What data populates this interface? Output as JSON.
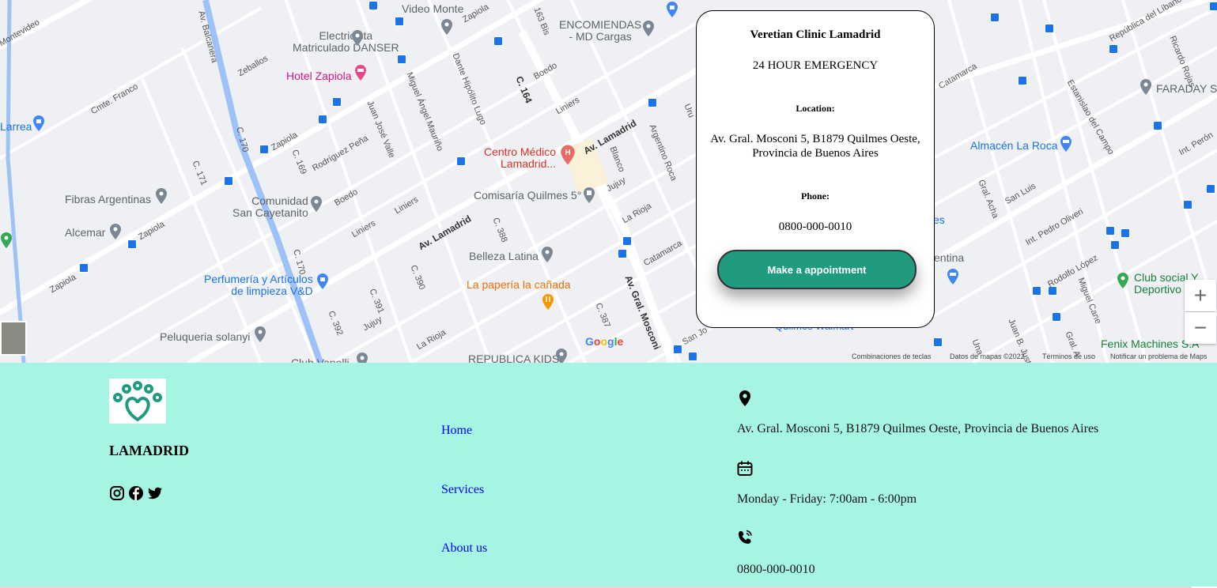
{
  "map": {
    "pois": [
      {
        "label": "Electricista\nMatriculado DANSER",
        "color": "gray"
      },
      {
        "label": "Video Monte",
        "color": "gray"
      },
      {
        "label": "ENCOMIENDAS\n- MD Cargas",
        "color": "gray"
      },
      {
        "label": "Hotel Zapiola",
        "color": "pink"
      },
      {
        "label": "Larrea",
        "color": "blue"
      },
      {
        "label": "Centro Médico\nLamadrid...",
        "color": "red"
      },
      {
        "label": "Fibras Argentinas",
        "color": "gray"
      },
      {
        "label": "Comunidad\nSan Cayetanito",
        "color": "gray"
      },
      {
        "label": "Comisaría Quilmes 5°",
        "color": "gray"
      },
      {
        "label": "Alcemar",
        "color": "gray"
      },
      {
        "label": "Belleza Latina",
        "color": "gray"
      },
      {
        "label": "Perfumería y Artículos\nde limpieza V&D",
        "color": "blue"
      },
      {
        "label": "La papería la cañada",
        "color": "orange"
      },
      {
        "label": "Peluqueria solanyi",
        "color": "gray"
      },
      {
        "label": "REPUBLICA KIDS",
        "color": "gray"
      },
      {
        "label": "FARADAY SA",
        "color": "gray"
      },
      {
        "label": "Almacén La Roca",
        "color": "blue"
      },
      {
        "label": "Club social Y\nDeportivo",
        "color": "green"
      },
      {
        "label": "Fenix Machines S.A",
        "color": "green"
      },
      {
        "label": "entina",
        "color": "gray"
      },
      {
        "label": "es",
        "color": "blue"
      },
      {
        "label": "Quilmes Walmart",
        "color": "blue"
      },
      {
        "label": "Club Vanelli",
        "color": "gray"
      }
    ],
    "streets": [
      "Zapiola",
      "Zapiola",
      "Zapiola",
      "Zapiola",
      "Av. Lamadrid",
      "Av. Lamadrid",
      "Av. Gral. Mosconi",
      "Juan José Valle",
      "Miguel Ángel Mauriño",
      "Dante Hipólito Lugo",
      "Boedo",
      "Boedo",
      "Liniers",
      "Liniers",
      "Liniers",
      "Jujuy",
      "Jujuy",
      "La Rioja",
      "La Rioja",
      "Catamarca",
      "Catamarca",
      "C. 164",
      "C. 170",
      "C. 170",
      "C. 169",
      "C. 171",
      "C. 388",
      "C. 390",
      "C. 391",
      "C. 392",
      "C. 387",
      "Rodríguez Peña",
      "Cmte. Franco",
      "Zeballos",
      "Blanco",
      "Argentino Roca",
      "San Luis",
      "Int. Pedro Oliveri",
      "Gral. Acha",
      "Rodolfo López",
      "Miguel Cane",
      "Estanislao del Campo",
      "República del Líbano",
      "Ricardo Rojas",
      "Int. Perón",
      "Juan B. Justo",
      "Gral. A",
      "Una",
      "San Jo",
      "163 Bis",
      "Montevideo",
      "Av. Balcanera",
      "Uru"
    ],
    "google": "Google",
    "footer_links": [
      "Combinaciones de teclas",
      "Datos de mapas ©2022",
      "Términos de uso",
      "Notificar un problema de Maps"
    ],
    "zoom_in": "+",
    "zoom_out": "−"
  },
  "card": {
    "title": "Veretian Clinic Lamadrid",
    "subtitle": "24 HOUR EMERGENCY",
    "location_label": "Location:",
    "location": "Av. Gral. Mosconi 5, B1879 Quilmes Oeste, Provincia de Buenos Aires",
    "phone_label": "Phone:",
    "phone": "0800-000-0010",
    "button": "Make a appointment"
  },
  "footer": {
    "brand": "LAMADRID",
    "social": [
      "instagram-icon",
      "facebook-icon",
      "twitter-icon"
    ],
    "nav": [
      "Home",
      "Services",
      "About us"
    ],
    "address": "Av. Gral. Mosconi 5, B1879 Quilmes Oeste, Provincia de Buenos Aires",
    "hours": "Monday - Friday: 7:00am - 6:00pm",
    "phone": "0800-000-0010"
  },
  "colors": {
    "footer_bg": "#a6f4e3",
    "accent": "#1f9b80",
    "link": "#0000ee"
  }
}
